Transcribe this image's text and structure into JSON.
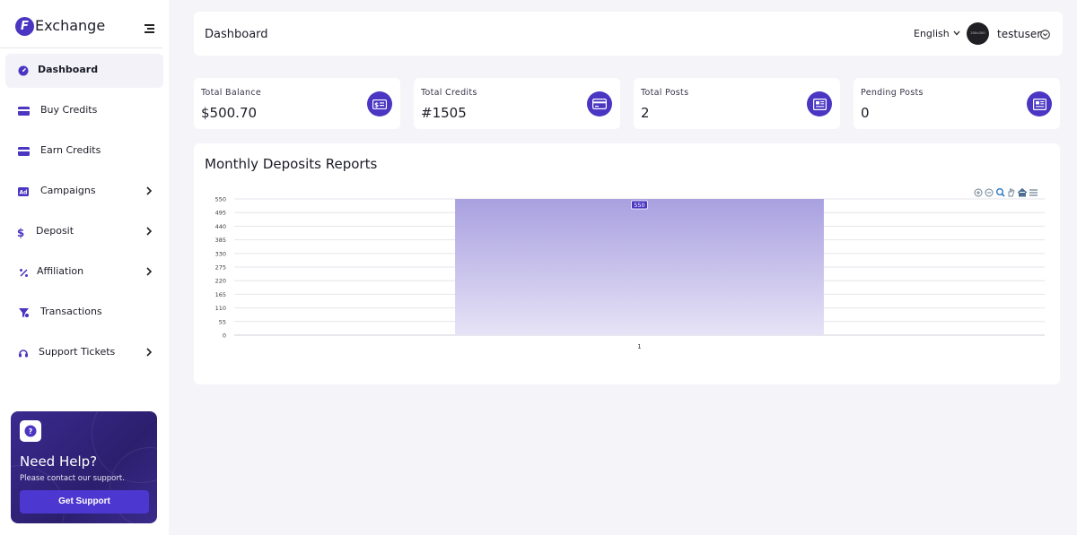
{
  "app": {
    "name": "Exchange",
    "logo_letter": "F"
  },
  "sidebar": {
    "items": [
      {
        "label": "Dashboard",
        "icon": "dashboard-icon",
        "active": true
      },
      {
        "label": "Buy Credits",
        "icon": "credit-card-icon"
      },
      {
        "label": "Earn Credits",
        "icon": "credit-card-icon"
      },
      {
        "label": "Campaigns",
        "icon": "ad-icon",
        "has_submenu": true
      },
      {
        "label": "Deposit",
        "icon": "dollar-icon",
        "has_submenu": true
      },
      {
        "label": "Affiliation",
        "icon": "percent-icon",
        "has_submenu": true
      },
      {
        "label": "Transactions",
        "icon": "transactions-icon"
      },
      {
        "label": "Support Tickets",
        "icon": "headset-icon",
        "has_submenu": true
      }
    ],
    "help": {
      "title": "Need Help?",
      "subtitle": "Please contact our support.",
      "button": "Get Support"
    }
  },
  "header": {
    "title": "Dashboard",
    "language": "English",
    "avatar_text": "200×200",
    "username": "testuser"
  },
  "stats": [
    {
      "label": "Total Balance",
      "value": "$500.70",
      "icon": "money-icon"
    },
    {
      "label": "Total Credits",
      "value": "#1505",
      "icon": "credit-card-icon"
    },
    {
      "label": "Total Posts",
      "value": "2",
      "icon": "newspaper-icon"
    },
    {
      "label": "Pending Posts",
      "value": "0",
      "icon": "newspaper-icon"
    }
  ],
  "chart": {
    "title": "Monthly Deposits Reports"
  },
  "colors": {
    "accent": "#4a36c2",
    "bar_top": "#a9a0e0",
    "bar_bottom": "#e6e3f6"
  },
  "chart_data": {
    "type": "bar",
    "categories": [
      "1"
    ],
    "values": [
      550
    ],
    "title": "Monthly Deposits Reports",
    "xlabel": "",
    "ylabel": "",
    "ylim": [
      0,
      550
    ],
    "yticks": [
      0,
      55,
      110,
      165,
      220,
      275,
      330,
      385,
      440,
      495,
      550
    ],
    "data_labels": true,
    "grid": true
  }
}
